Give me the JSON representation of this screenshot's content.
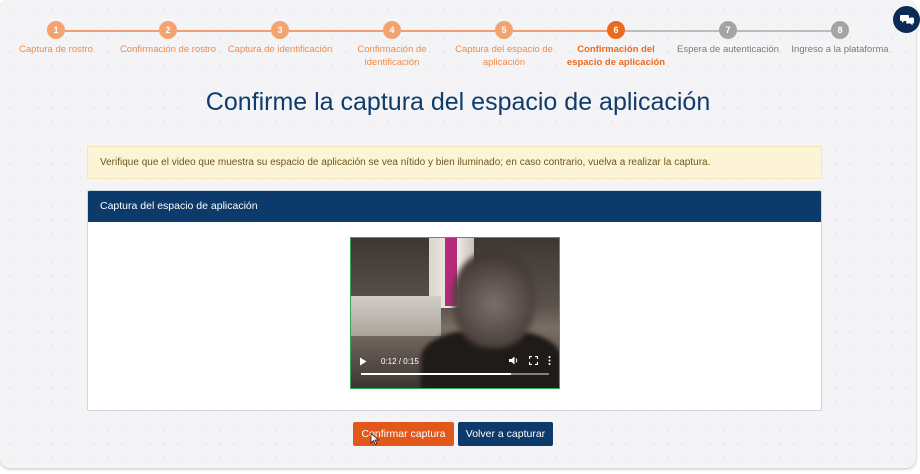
{
  "stepper": {
    "steps": [
      {
        "number": "1",
        "label": "Captura de rostro",
        "state": "done"
      },
      {
        "number": "2",
        "label": "Confirmación de rostro",
        "state": "done"
      },
      {
        "number": "3",
        "label": "Captura de identificación",
        "state": "done"
      },
      {
        "number": "4",
        "label": "Confirmación de identificación",
        "state": "done"
      },
      {
        "number": "5",
        "label": "Captura del espacio de aplicación",
        "state": "done"
      },
      {
        "number": "6",
        "label": "Confirmación del espacio de aplicación",
        "state": "active"
      },
      {
        "number": "7",
        "label": "Espera de autenticación",
        "state": "todo"
      },
      {
        "number": "8",
        "label": "Ingreso a la plataforma",
        "state": "todo"
      }
    ]
  },
  "page": {
    "title": "Confirme la captura del espacio de aplicación"
  },
  "alert": {
    "text": "Verifique que el video que muestra su espacio de aplicación se vea nítido y bien iluminado; en caso contrario, vuelva a realizar la captura."
  },
  "card": {
    "header": "Captura del espacio de aplicación",
    "video": {
      "time": "0:12 / 0:15",
      "progress": 0.8
    }
  },
  "buttons": {
    "confirm": "Confirmar captura",
    "retake": "Volver a capturar"
  },
  "icons": {
    "chat": "chat-bubbles-icon",
    "play": "play-icon",
    "volume": "volume-icon",
    "fullscreen": "fullscreen-icon",
    "more": "more-options-icon"
  },
  "colors": {
    "accent": "#ec6a1f",
    "primary": "#0c3a6b",
    "pending": "#a4a4a4"
  }
}
